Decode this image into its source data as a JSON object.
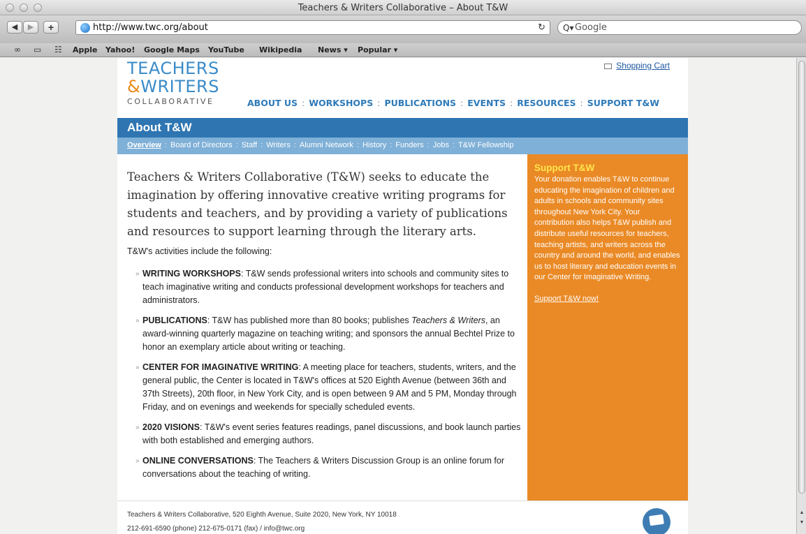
{
  "browser": {
    "window_title": "Teachers & Writers Collaborative – About T&W",
    "url": "http://www.twc.org/about",
    "search_placeholder": "Google",
    "bookmarks": [
      "Apple",
      "Yahoo!",
      "Google Maps",
      "YouTube",
      "Wikipedia",
      "News ▾",
      "Popular ▾"
    ]
  },
  "header": {
    "logo_line1": "TEACHERS",
    "logo_amp": "&",
    "logo_line2": "WRITERS",
    "logo_sub": "COLLABORATIVE",
    "cart_label": "Shopping Cart",
    "nav": [
      "ABOUT US",
      "WORKSHOPS",
      "PUBLICATIONS",
      "EVENTS",
      "RESOURCES",
      "SUPPORT T&W"
    ],
    "nav_separator": ":"
  },
  "section": {
    "title": "About T&W",
    "subnav": [
      "Overview",
      "Board of Directors",
      "Staff",
      "Writers",
      "Alumni Network",
      "History",
      "Funders",
      "Jobs",
      "T&W Fellowship"
    ]
  },
  "content": {
    "lede": "Teachers & Writers Collaborative (T&W) seeks to educate the imagination by offering innovative creative writing programs for students and teachers, and by providing a variety of publications and resources to support learning through the literary arts.",
    "intro": "T&W's activities include the following:",
    "items": [
      {
        "title": "WRITING WORKSHOPS",
        "text": ": T&W sends professional writers into schools and community sites to teach imaginative writing and conducts professional development workshops for teachers and administrators."
      },
      {
        "title": "PUBLICATIONS",
        "text": ": T&W has published more than 80 books; publishes ",
        "italic": "Teachers & Writers",
        "text2": ", an award-winning quarterly magazine on teaching writing; and sponsors the annual Bechtel Prize to honor an exemplary article about writing or teaching."
      },
      {
        "title": "CENTER FOR IMAGINATIVE WRITING",
        "text": ": A meeting place for teachers, students, writers, and the general public, the Center is located in T&W's offices at 520 Eighth Avenue (between 36th and 37th Streets), 20th floor, in New York City, and is open between 9 AM and 5 PM, Monday through Friday, and on evenings and weekends for specially scheduled events."
      },
      {
        "title": "2020 VISIONS",
        "text": ": T&W's event series features readings, panel discussions, and book launch parties with both established and emerging authors."
      },
      {
        "title": "ONLINE CONVERSATIONS",
        "text": ": The Teachers & Writers Discussion Group is an online forum for conversations about the teaching of writing."
      }
    ]
  },
  "sidebar": {
    "title": "Support T&W",
    "text": "Your donation enables T&W to continue educating the imagination of children and adults in schools and community sites throughout New York City. Your contribution also helps T&W publish and distribute useful resources for teachers, teaching artists, and writers across the country and around the world, and enables us to host literary and education events in our Center for Imaginative Writing.",
    "link": "Support T&W now!"
  },
  "footer": {
    "address": "Teachers & Writers Collaborative, 520 Eighth Avenue, Suite 2020, New York, NY 10018",
    "contact": "212-691-6590 (phone) 212-675-0171 (fax) / info@twc.org"
  },
  "colors": {
    "brand_blue": "#2e75b2",
    "brand_orange": "#ea8a26",
    "sidebar_title": "#ffe64d"
  }
}
